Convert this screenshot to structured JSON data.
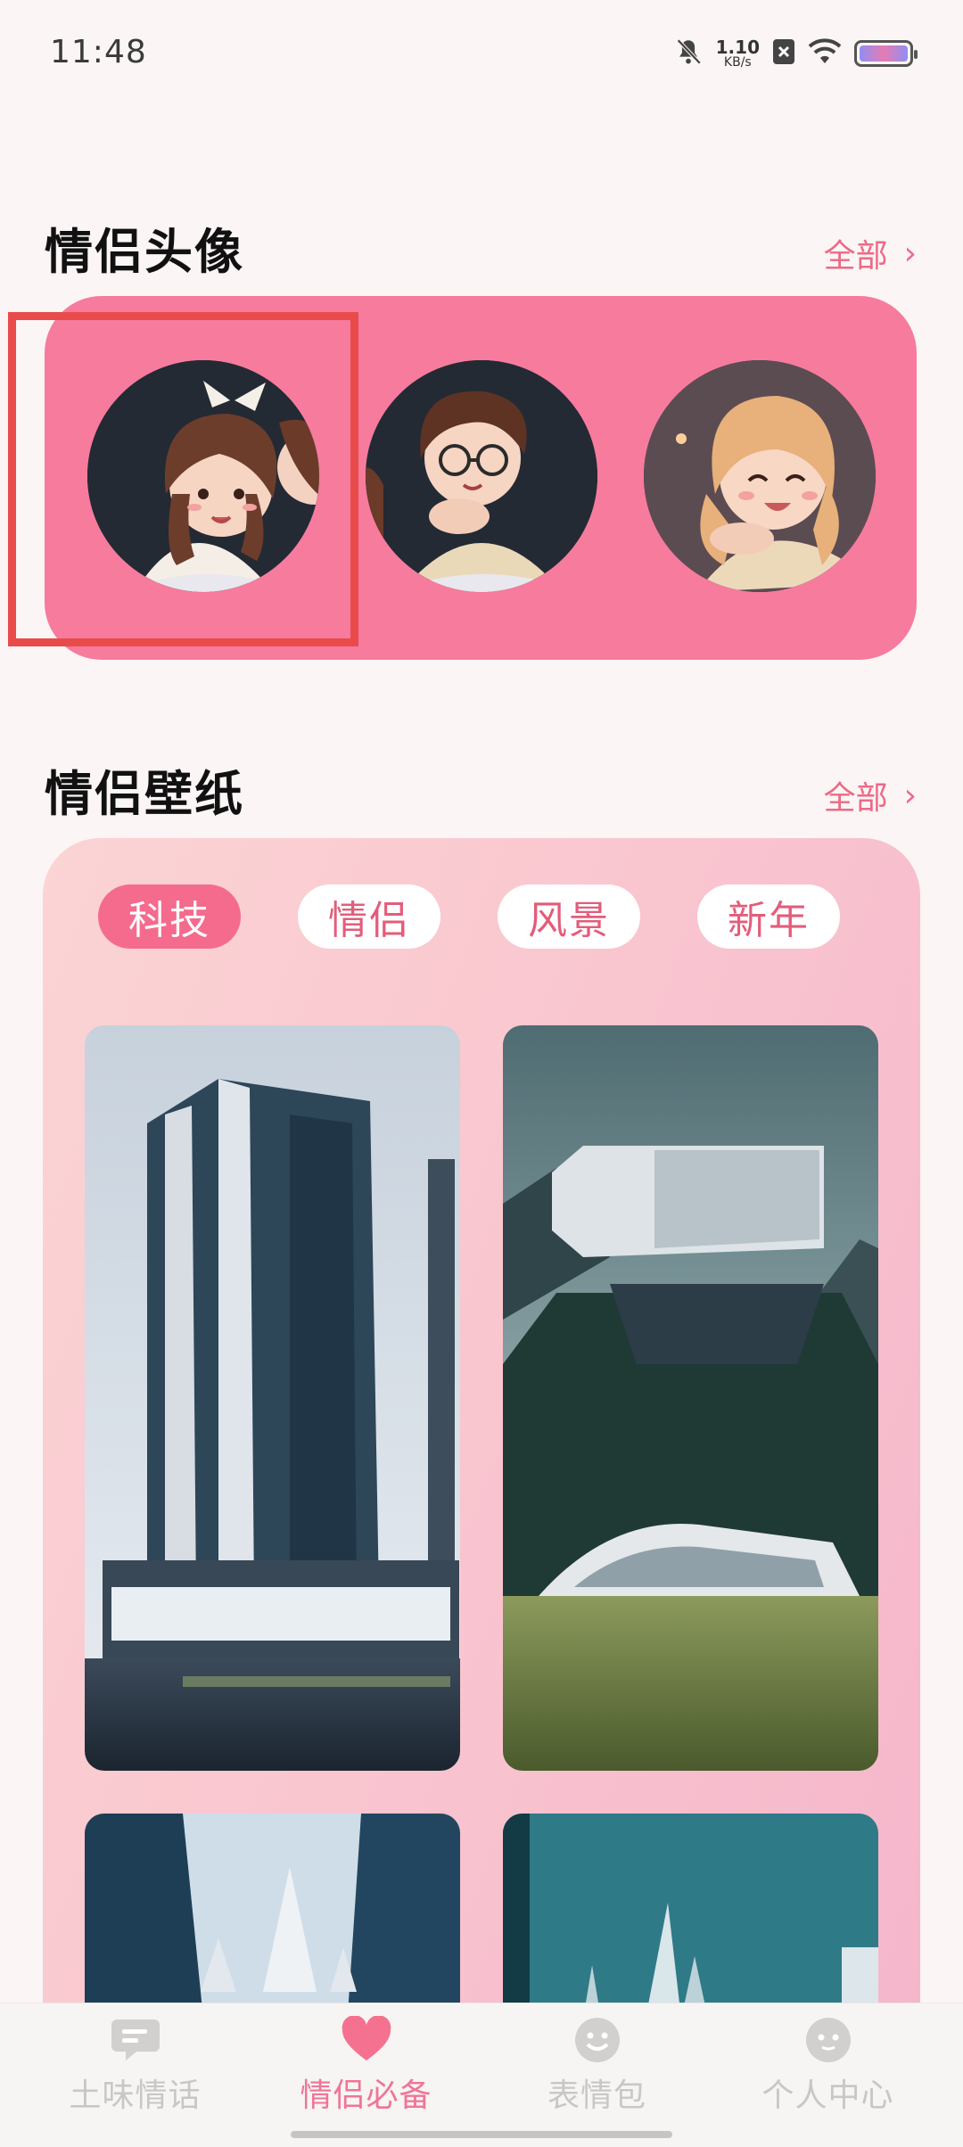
{
  "status_bar": {
    "time": "11:48",
    "net_speed_value": "1.10",
    "net_speed_unit": "KB/s",
    "icons": [
      "bell-muted-icon",
      "sim-x-icon",
      "wifi-icon",
      "battery-icon"
    ]
  },
  "avatar_section": {
    "title": "情侣头像",
    "more_label": "全部"
  },
  "wallpaper_section": {
    "title": "情侣壁纸",
    "more_label": "全部",
    "categories": [
      "科技",
      "情侣",
      "风景",
      "新年"
    ],
    "selected_category": "科技"
  },
  "bottom_nav": {
    "items": [
      {
        "label": "土味情话",
        "icon": "chat-bubble-icon"
      },
      {
        "label": "情侣必备",
        "icon": "heart-icon"
      },
      {
        "label": "表情包",
        "icon": "smile-icon"
      },
      {
        "label": "个人中心",
        "icon": "person-face-icon"
      }
    ],
    "active_index": 1
  },
  "colors": {
    "accent": "#f56b8d",
    "avatar_card": "#f67b9d",
    "highlight_box": "#e94b4b",
    "nav_inactive": "#c9c6c6"
  }
}
